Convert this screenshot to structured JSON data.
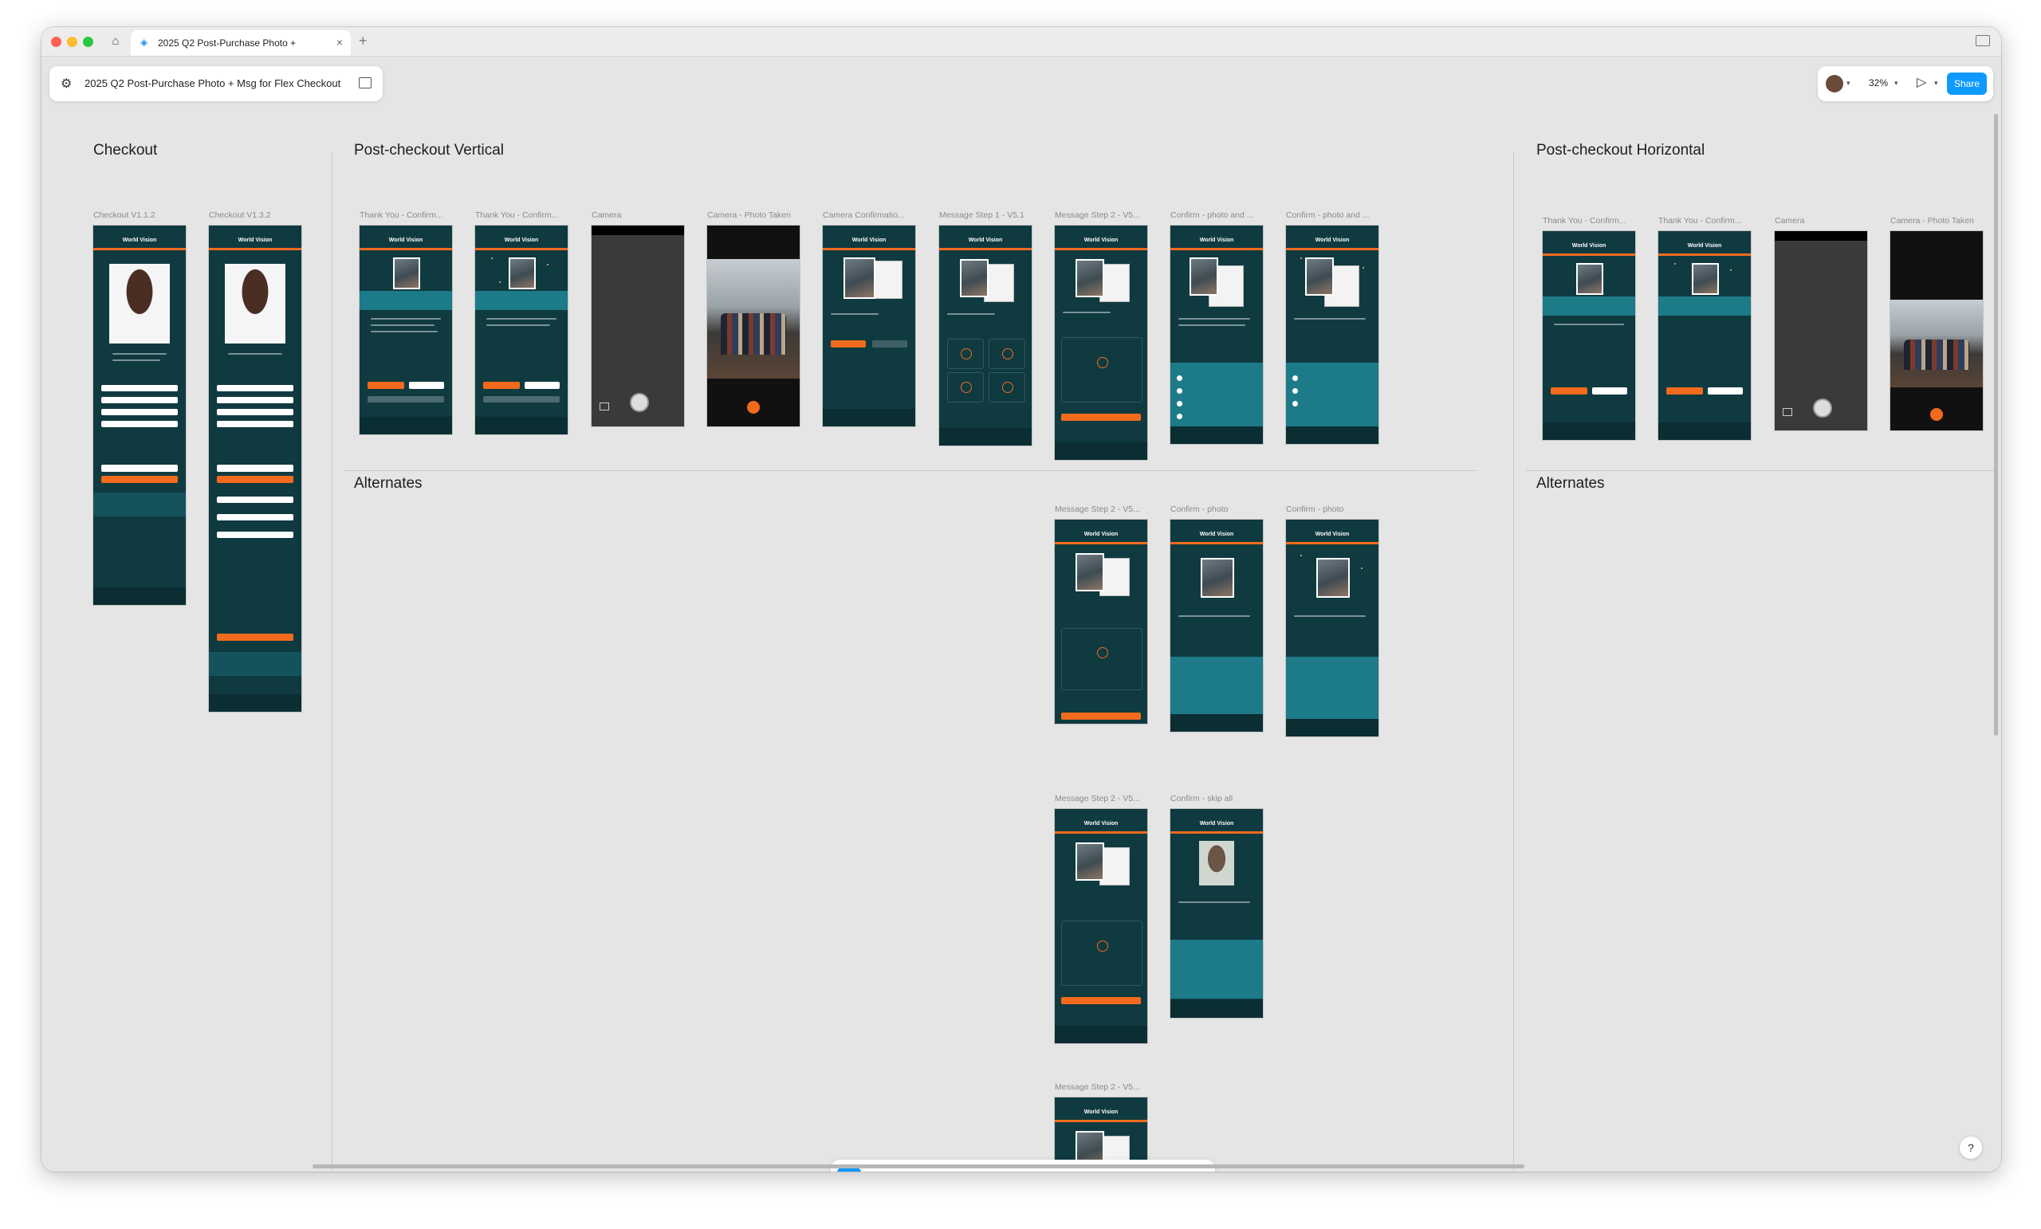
{
  "window": {
    "tab_title": "2025 Q2 Post-Purchase Photo +",
    "new_tab_icon": "plus-icon"
  },
  "file": {
    "name": "2025 Q2 Post-Purchase Photo + Msg for Flex Checkout"
  },
  "header": {
    "zoom": "32%",
    "share_label": "Share"
  },
  "sections": {
    "checkout": "Checkout",
    "vertical": "Post-checkout Vertical",
    "horizontal": "Post-checkout Horizontal",
    "alternates_vertical": "Alternates",
    "alternates_horizontal": "Alternates"
  },
  "frames": {
    "checkout_v112": "Checkout V1.1.2",
    "checkout_v132": "Checkout V1.3.2",
    "v_thankyou_1": "Thank You - Confirm...",
    "v_thankyou_2": "Thank You - Confirm...",
    "v_camera": "Camera",
    "v_camera_taken": "Camera - Photo Taken",
    "v_camera_confirm": "Camera Confirmatio...",
    "v_msg_step1": "Message Step 1 - V5.1",
    "v_msg_step2": "Message Step 2 - V5...",
    "v_confirm_photo_1": "Confirm - photo and ...",
    "v_confirm_photo_2": "Confirm - photo and ...",
    "alt_msg_step2_a": "Message Step 2 - V5...",
    "alt_confirm_photo_a": "Confirm - photo",
    "alt_confirm_photo_b": "Confirm - photo",
    "alt_msg_step2_b": "Message Step 2 - V5...",
    "alt_confirm_skip": "Confirm - skip all",
    "alt_msg_step2_c": "Message Step 2 - V5...",
    "h_thankyou_1": "Thank You - Confirm...",
    "h_thankyou_2": "Thank You - Confirm...",
    "h_camera": "Camera",
    "h_camera_taken": "Camera - Photo Taken"
  },
  "colors": {
    "brand_dark": "#0f3a40",
    "brand_orange": "#f26b1d",
    "accent_teal": "#1d7a88",
    "share_blue": "#0d99ff"
  },
  "toolbar": {
    "tools": [
      "move-icon",
      "frame-icon",
      "shape-icon",
      "pen-icon",
      "text-icon",
      "comment-icon",
      "actions-icon",
      "draw-icon",
      "design-mode-icon",
      "prototype-icon",
      "dev-mode-icon"
    ]
  },
  "help": {
    "label": "?"
  }
}
